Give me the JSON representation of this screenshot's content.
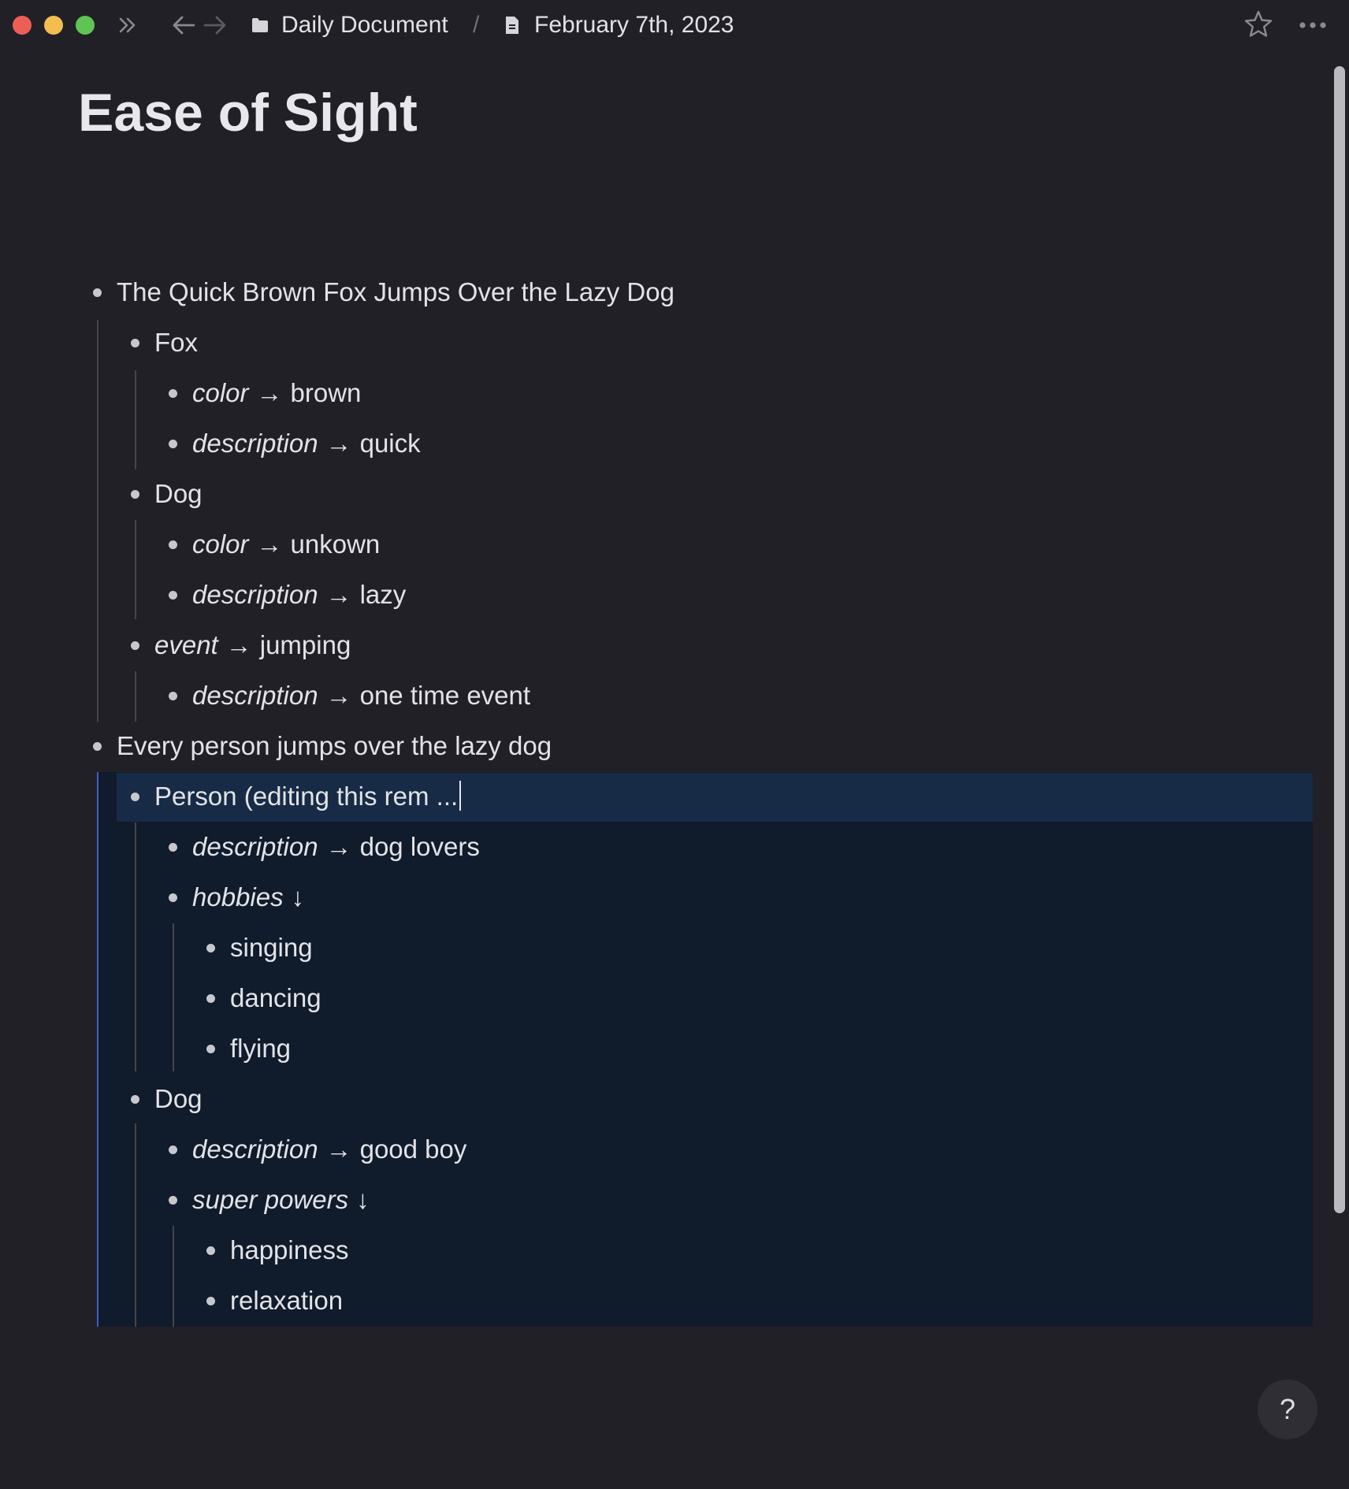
{
  "header": {
    "breadcrumb_parent": "Daily Document",
    "breadcrumb_separator": "/",
    "breadcrumb_current": "February 7th, 2023"
  },
  "icons": {
    "sidebar_toggle": "double-chevron-right-icon",
    "back": "arrow-left-icon",
    "forward": "arrow-right-icon",
    "folder": "folder-icon",
    "document": "document-icon",
    "favorite": "star-icon",
    "more": "more-icon",
    "help": "help-icon"
  },
  "colors": {
    "background": "#212026",
    "highlight_block": "#101b2c",
    "highlight_row": "#172b47",
    "focus_line": "#3b5fc9"
  },
  "page": {
    "title": "Ease of Sight"
  },
  "outline": {
    "arrow_right": "→",
    "arrow_down": "↓",
    "r1": "The Quick Brown Fox Jumps Over the Lazy Dog",
    "r2": "Fox",
    "r3_key": "color",
    "r3_val": "brown",
    "r4_key": "description",
    "r4_val": "quick",
    "r5": "Dog",
    "r6_key": "color",
    "r6_val": "unkown",
    "r7_key": "description",
    "r7_val": "lazy",
    "r8_key": "event",
    "r8_val": "jumping",
    "r9_key": "description",
    "r9_val": "one time event",
    "r10": "Every person jumps over the lazy dog",
    "r11": "Person (editing this rem ...",
    "r12_key": "description",
    "r12_val": "dog lovers",
    "r13_key": "hobbies",
    "r14": "singing",
    "r15": "dancing",
    "r16": "flying",
    "r17": "Dog",
    "r18_key": "description",
    "r18_val": "good boy",
    "r19_key": "super powers",
    "r20": "happiness",
    "r21": "relaxation"
  },
  "help": {
    "label": "?"
  }
}
